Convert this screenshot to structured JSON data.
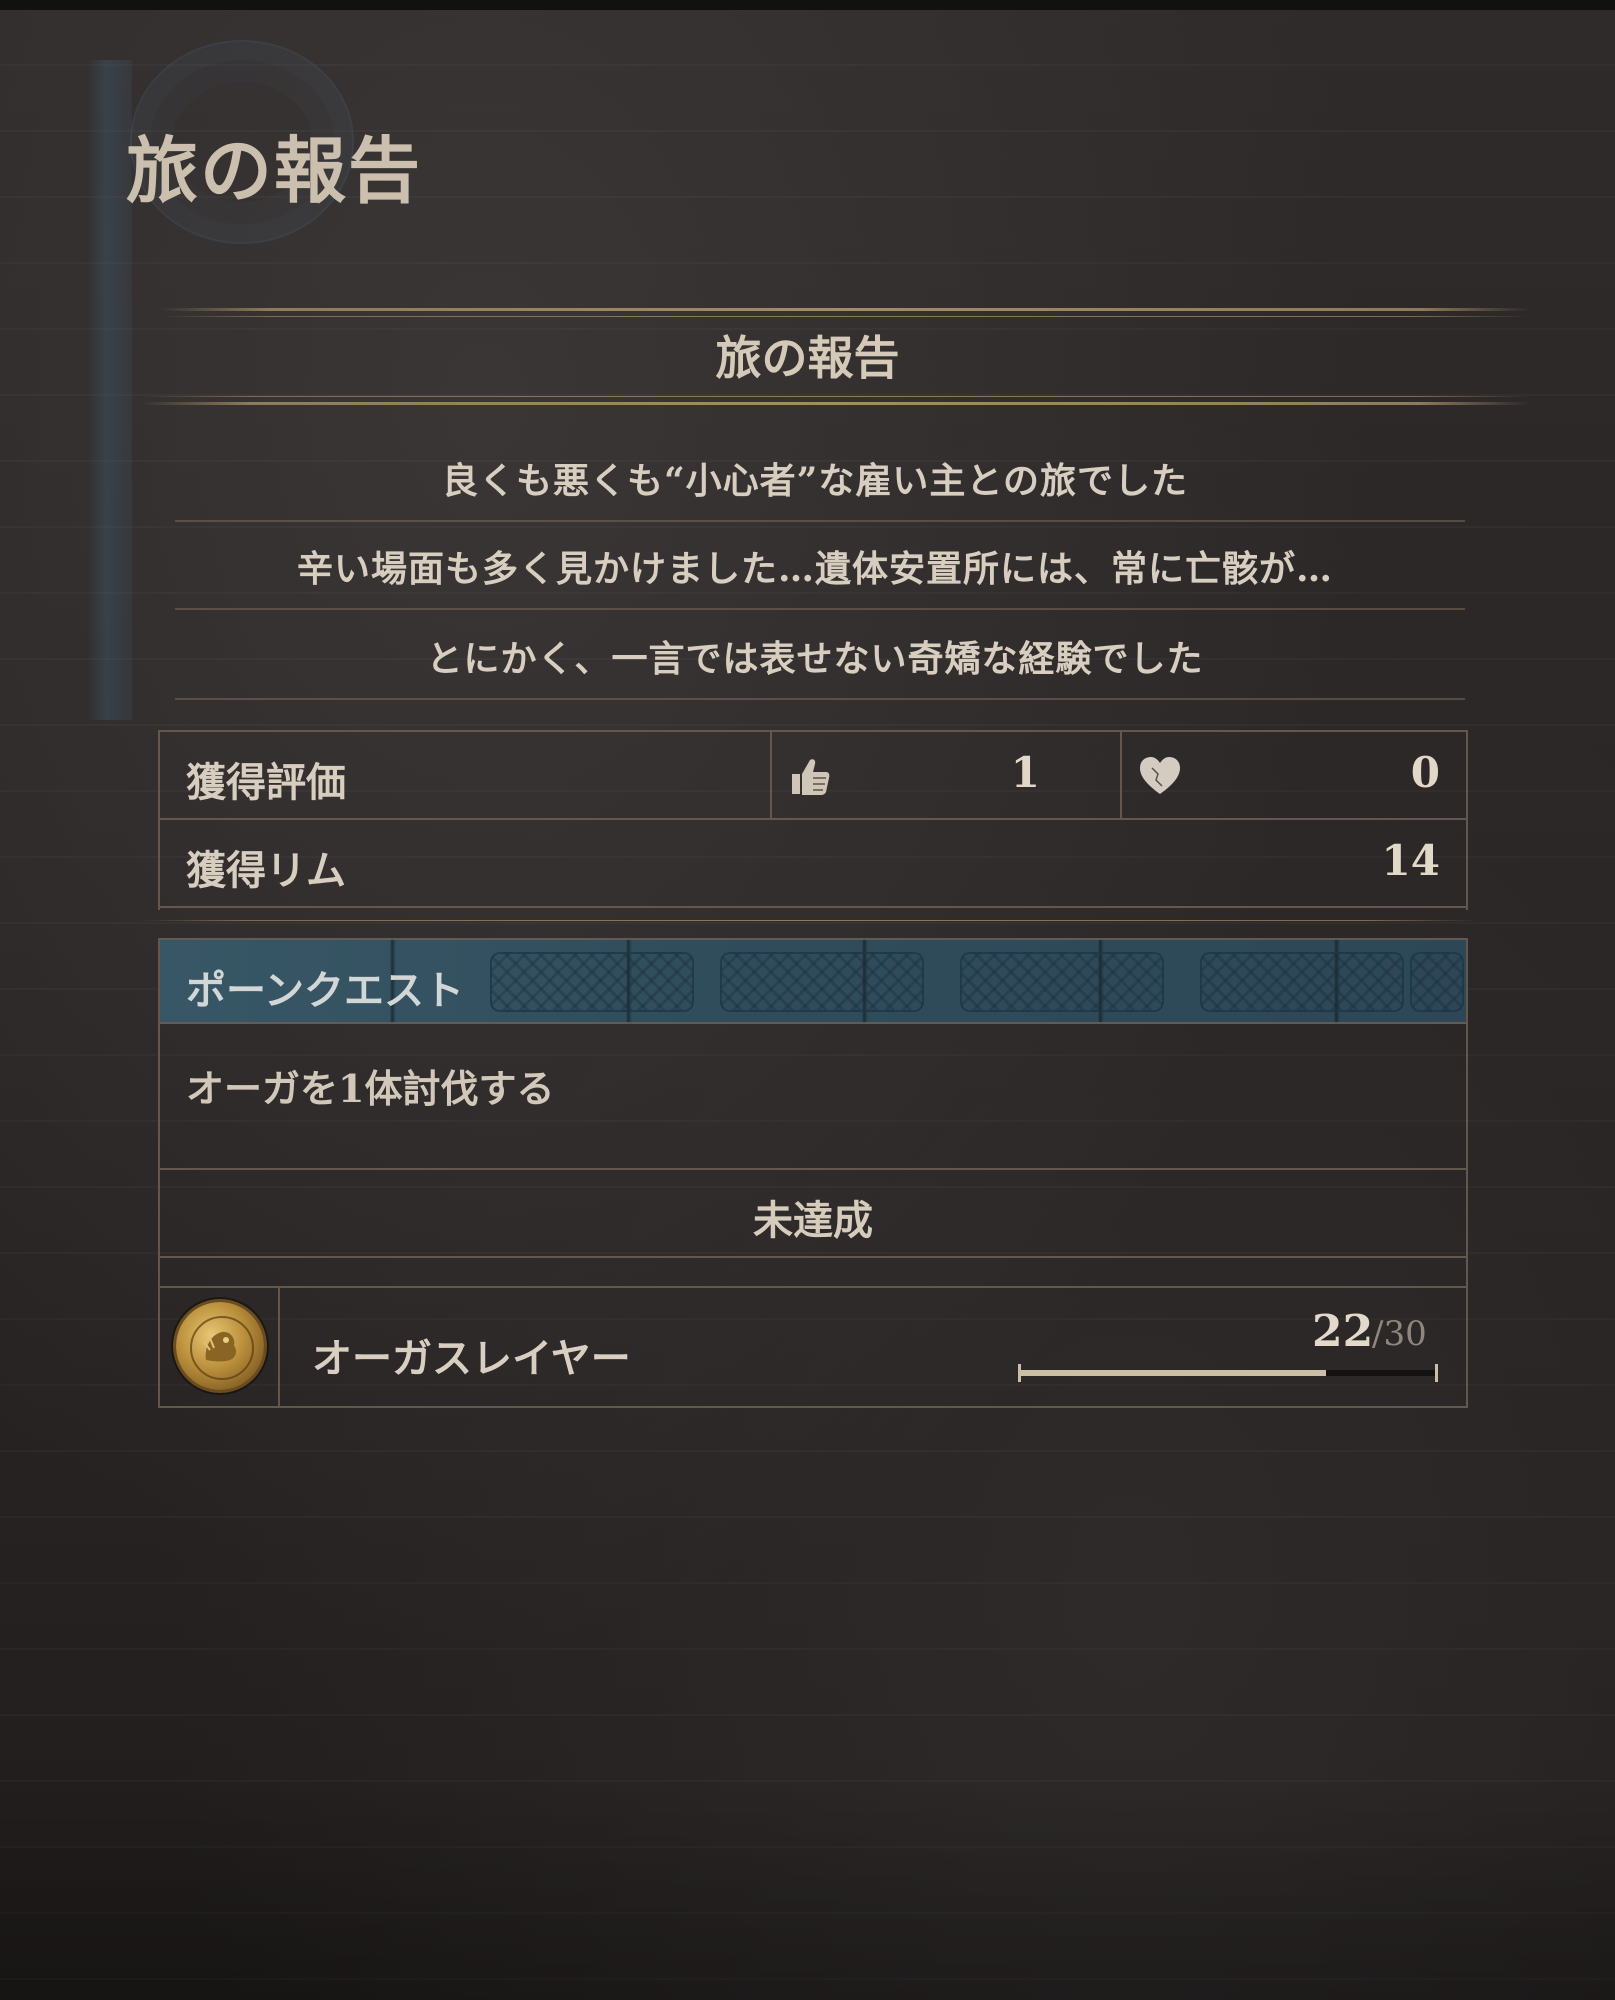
{
  "page": {
    "title": "旅の報告"
  },
  "report": {
    "heading": "旅の報告",
    "lines": [
      "良くも悪くも“小心者”な雇い主との旅でした",
      "辛い場面も多く見かけました…遺体安置所には、常に亡骸が…",
      "とにかく、一言では表せない奇矯な経験でした"
    ]
  },
  "stats": {
    "rating": {
      "label": "獲得評価",
      "likes_icon": "thumbs-up-icon",
      "likes": "1",
      "hearts_icon": "heart-icon",
      "hearts": "0"
    },
    "rim": {
      "label": "獲得リム",
      "value": "14"
    }
  },
  "quest": {
    "header": "ポーンクエスト",
    "description": "オーガを1体討伐する",
    "status": "未達成",
    "achievement": {
      "icon": "ogre-medal-icon",
      "name": "オーガスレイヤー",
      "current": "22",
      "total": "/30",
      "progress_fraction": 0.733
    }
  },
  "colors": {
    "accent_gold": "#a38d65",
    "quest_blue": "#385766",
    "text": "#d8cebf"
  }
}
